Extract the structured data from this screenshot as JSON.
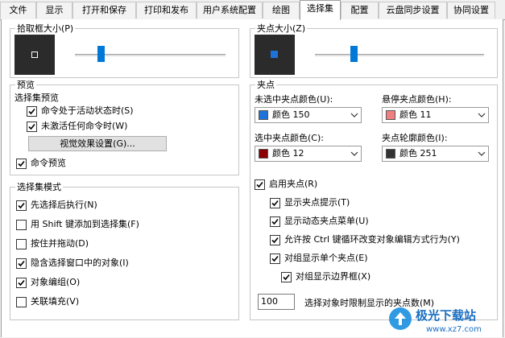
{
  "tabs": [
    "文件",
    "显示",
    "打开和保存",
    "打印和发布",
    "用户系统配置",
    "绘图",
    "选择集",
    "配置",
    "云盘同步设置",
    "协同设置"
  ],
  "active_tab": "选择集",
  "pickbox": {
    "title": "拾取框大小(P)",
    "slider_fraction": 0.17
  },
  "grip_size": {
    "title": "夹点大小(Z)",
    "slider_fraction": 0.23
  },
  "preview": {
    "title": "预览",
    "subtitle": "选择集预览",
    "when_active": "命令处于活动状态时(S)",
    "when_inactive": "未激活任何命令时(W)",
    "visual_button": "视觉效果设置(G)...",
    "command_preview": "命令预览"
  },
  "selection_modes": {
    "title": "选择集模式",
    "items": [
      {
        "label": "先选择后执行(N)",
        "checked": true
      },
      {
        "label": "用 Shift 键添加到选择集(F)",
        "checked": false
      },
      {
        "label": "按住并拖动(D)",
        "checked": false
      },
      {
        "label": "隐含选择窗口中的对象(I)",
        "checked": true
      },
      {
        "label": "对象编组(O)",
        "checked": true
      },
      {
        "label": "关联填充(V)",
        "checked": false
      }
    ]
  },
  "grips": {
    "title": "夹点",
    "unselected_label": "未选中夹点颜色(U):",
    "unselected_value": "颜色 150",
    "unselected_color": "#1e73d9",
    "hover_label": "悬停夹点颜色(H):",
    "hover_value": "颜色 11",
    "hover_color": "#f08080",
    "selected_label": "选中夹点颜色(C):",
    "selected_value": "颜色 12",
    "selected_color": "#8b0000",
    "outline_label": "夹点轮廓颜色(I):",
    "outline_value": "颜色 251",
    "outline_color": "#333333",
    "enable_grips": "启用夹点(R)",
    "show_tips": "显示夹点提示(T)",
    "show_dynamic_menu": "显示动态夹点菜单(U)",
    "allow_ctrl_cycling": "允许按 Ctrl 键循环改变对象编辑方式行为(Y)",
    "group_single_grip": "对组显示单个夹点(E)",
    "group_bounding_box": "对组显示边界框(X)",
    "limit_value": "100",
    "limit_label": "选择对象时限制显示的夹点数(M)"
  },
  "watermark": {
    "text": "极光下载站",
    "site": "www.xz7.com"
  }
}
